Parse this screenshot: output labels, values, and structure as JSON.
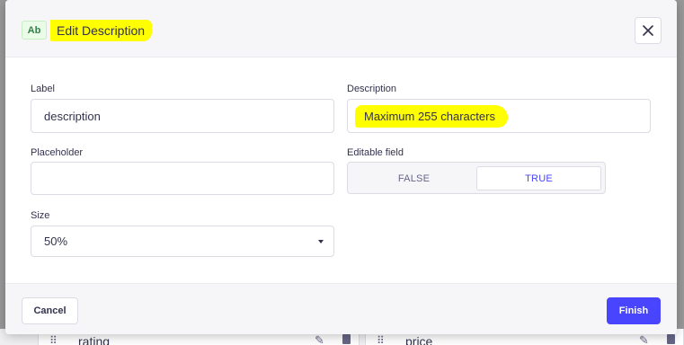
{
  "header": {
    "badge": "Ab",
    "title": "Edit Description",
    "close_icon": "close-icon"
  },
  "form": {
    "label": {
      "label": "Label",
      "value": "description"
    },
    "description": {
      "label": "Description",
      "value": "Maximum 255 characters"
    },
    "placeholder": {
      "label": "Placeholder",
      "value": ""
    },
    "editable": {
      "label": "Editable field",
      "options": [
        "FALSE",
        "TRUE"
      ],
      "selected": "TRUE"
    },
    "size": {
      "label": "Size",
      "value": "50%"
    }
  },
  "footer": {
    "cancel_label": "Cancel",
    "finish_label": "Finish"
  },
  "background": {
    "cards": [
      {
        "label": "rating"
      },
      {
        "label": "price"
      }
    ]
  },
  "colors": {
    "primary": "#4945ff",
    "highlight": "#ffff00",
    "badge_green": "#328048"
  }
}
